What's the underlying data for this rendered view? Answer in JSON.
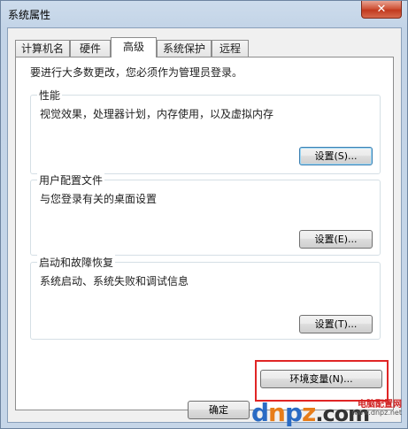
{
  "window": {
    "title": "系统属性",
    "close_glyph": "✕"
  },
  "tabs": [
    {
      "label": "计算机名"
    },
    {
      "label": "硬件"
    },
    {
      "label": "高级",
      "active": true
    },
    {
      "label": "系统保护"
    },
    {
      "label": "远程"
    }
  ],
  "admin_note": "要进行大多数更改，您必须作为管理员登录。",
  "groups": {
    "performance": {
      "title": "性能",
      "desc": "视觉效果，处理器计划，内存使用，以及虚拟内存",
      "button": "设置(S)..."
    },
    "profiles": {
      "title": "用户配置文件",
      "desc": "与您登录有关的桌面设置",
      "button": "设置(E)..."
    },
    "startup": {
      "title": "启动和故障恢复",
      "desc": "系统启动、系统失败和调试信息",
      "button": "设置(T)..."
    }
  },
  "env_button": "环境变量(N)...",
  "ok_button": "确定",
  "watermark": {
    "brand_top": "电脑配置网",
    "url": "www.dnpz.net",
    "logo_d": "d",
    "logo_n": "n",
    "logo_p": "p",
    "logo_z": "z",
    "logo_com": ".com"
  },
  "colors": {
    "highlight": "#e02525",
    "close_button": "#c23a1f"
  }
}
